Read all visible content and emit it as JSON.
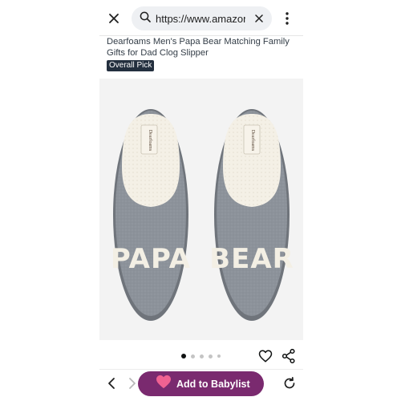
{
  "browser": {
    "url": "https://www.amazon.",
    "close_icon": "close-icon",
    "search_icon": "search-icon",
    "clear_icon": "clear-icon",
    "menu_icon": "more-vert-icon"
  },
  "product": {
    "title": "Dearfoams Men's Papa Bear Matching Family Gifts for Dad Clog Slipper",
    "badge": "Overall Pick",
    "image": {
      "left_text": "PAPA",
      "right_text": "BEAR",
      "label_text": "Dearfoams"
    }
  },
  "carousel": {
    "count": 5,
    "active_index": 0
  },
  "actions": {
    "wishlist_icon": "heart-outline-icon",
    "share_icon": "share-icon"
  },
  "toolbar": {
    "back_icon": "chevron-left-icon",
    "forward_icon": "chevron-right-icon",
    "babylist_label": "Add to Babylist",
    "babylist_icon": "heart-icon",
    "reload_icon": "reload-icon"
  },
  "colors": {
    "babylist_purple": "#7a2a6f",
    "heart_pink": "#f06292",
    "badge_bg": "#232f3e",
    "slipper_felt": "#8e949c",
    "fleece": "#f3efe4"
  }
}
